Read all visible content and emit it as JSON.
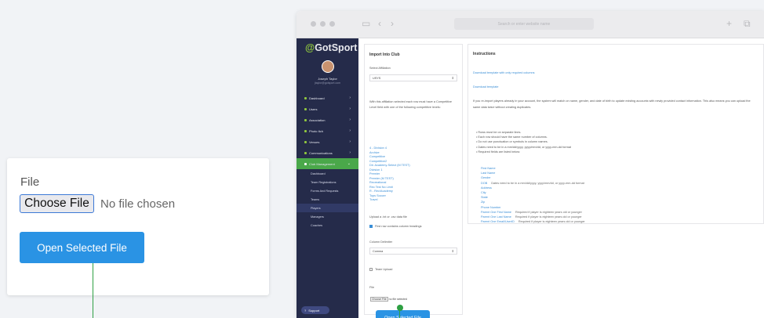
{
  "callout": {
    "label": "File",
    "choose_button": "Choose File",
    "no_file": "No file chosen",
    "open_button": "Open Selected File"
  },
  "browser": {
    "url": "Search or enter website name"
  },
  "sidebar": {
    "logo": "GotSport",
    "user_name": "Joseph Taylor",
    "user_email": "jtaylor@gotsport.com",
    "nav": [
      {
        "label": "Dashboard"
      },
      {
        "label": "Users"
      },
      {
        "label": "Association"
      },
      {
        "label": "Photo Itch"
      },
      {
        "label": "Venues"
      },
      {
        "label": "Communications"
      },
      {
        "label": "Club Management"
      }
    ],
    "sub": [
      {
        "label": "Dashboard"
      },
      {
        "label": "Team Registrations"
      },
      {
        "label": "Forms And Requests"
      },
      {
        "label": "Teams"
      },
      {
        "label": "Players"
      },
      {
        "label": "Managers"
      },
      {
        "label": "Coaches"
      }
    ],
    "support": "Support"
  },
  "import": {
    "title": "Import Into Club",
    "affiliation_label": "Select Affiliation",
    "affiliation_value": "USYS",
    "paragraph": "With this affiliation selected each row must have a Competitive Level field with one of the following competitive levels:",
    "levels": [
      "4 - Division 4",
      "Archive",
      "Competitive",
      "Competitive2",
      "Dir. Academy-Select (M TEST)",
      "Division 1",
      "Premier",
      "Premier (M TEST)",
      "Recreational",
      "Rec Test No Limit",
      "R - Rec/Academy",
      "Tops Soccer",
      "Travel"
    ],
    "upload_label": "Upload a .txt or .csv data file",
    "headings_label": "First row contains column headings",
    "delimiter_label": "Column Delimiter",
    "delimiter_value": "Comma",
    "team_upload_label": "Team Upload",
    "file_label": "File",
    "mini_choose": "Choose File",
    "mini_no_file": "no file selected",
    "open_button": "Open Selected File"
  },
  "instructions": {
    "title": "Instructions",
    "link1": "Download template with only required columns",
    "link2": "Download template",
    "paragraph": "If you re-import players already in your account, the system will match on name, gender, and date of birth to update existing accounts with newly provided contact information. This also means you can upload the same data twice without creating duplicates.",
    "bullets": [
      "Rows must be on separate lines.",
      "Each row should have the same number of columns.",
      "Do not use punctuation or symbols in column names.",
      "Dates need to be in a mm/dd/yyyy, yyyy/mm/dd, or yyyy-mm-dd format",
      "Required fields are listed below:"
    ],
    "fields": [
      {
        "name": "First Name",
        "note": ""
      },
      {
        "name": "Last Name",
        "note": ""
      },
      {
        "name": "Gender",
        "note": ""
      },
      {
        "name": "DOB",
        "note": "Dates need to be in a mm/dd/yyyy, yyyy/mm/dd, or yyyy-mm-dd format"
      },
      {
        "name": "Address",
        "note": ""
      },
      {
        "name": "City",
        "note": ""
      },
      {
        "name": "State",
        "note": ""
      },
      {
        "name": "Zip",
        "note": ""
      },
      {
        "name": "Phone Number",
        "note": ""
      },
      {
        "name": "Parent One First Name",
        "note": "Required if player is eighteen years old or younger"
      },
      {
        "name": "Parent One Last Name",
        "note": "Required if player is eighteen years old or younger"
      },
      {
        "name": "Parent One Email/UserID",
        "note": "Required if player is eighteen years old or younger"
      }
    ]
  }
}
